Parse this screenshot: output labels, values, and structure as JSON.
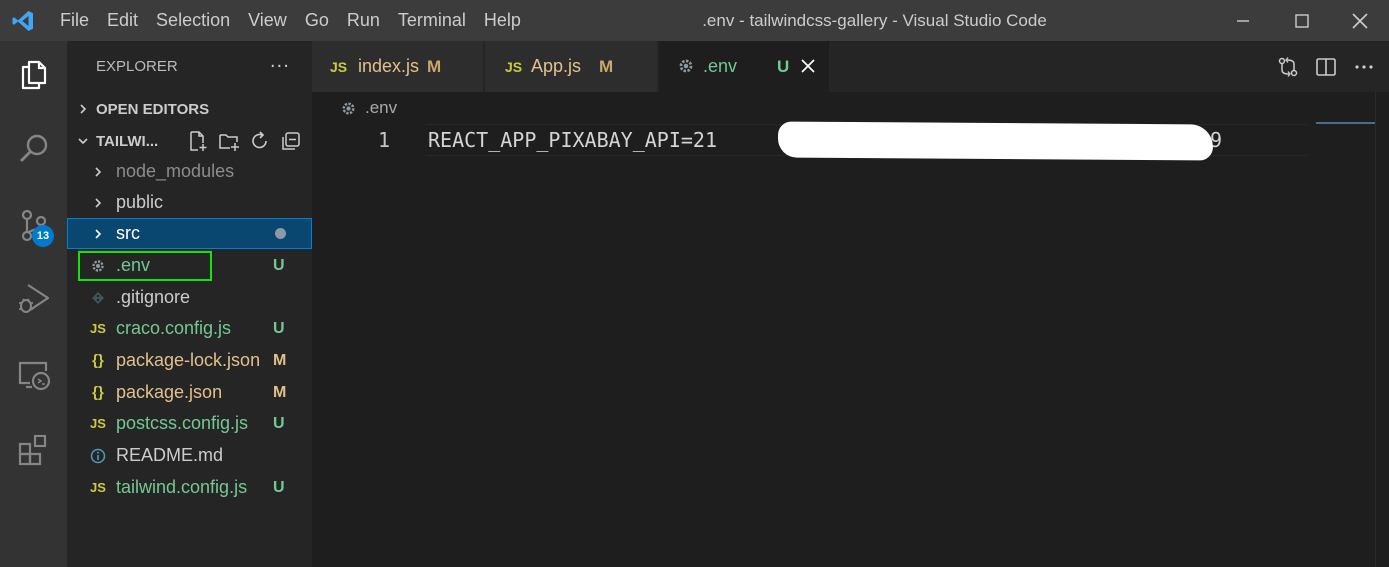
{
  "window": {
    "title": ".env - tailwindcss-gallery - Visual Studio Code",
    "menu": [
      "File",
      "Edit",
      "Selection",
      "View",
      "Go",
      "Run",
      "Terminal",
      "Help"
    ]
  },
  "activity_bar": {
    "items": [
      "files-icon",
      "search-icon",
      "source-control-icon",
      "run-debug-icon",
      "remote-explorer-icon",
      "extensions-icon"
    ],
    "source_control_badge": "13"
  },
  "sidebar": {
    "title": "EXPLORER",
    "more": "···",
    "open_editors_label": "OPEN EDITORS",
    "project_label": "TAILWI...",
    "files": [
      {
        "name": "node_modules",
        "icon": ">",
        "status": ""
      },
      {
        "name": "public",
        "icon": ">",
        "status": ""
      },
      {
        "name": "src",
        "icon": ">",
        "status": ""
      },
      {
        "name": ".env",
        "icon": "gear",
        "status": "U"
      },
      {
        "name": ".gitignore",
        "icon": "git",
        "status": ""
      },
      {
        "name": "craco.config.js",
        "icon": "JS",
        "status": "U"
      },
      {
        "name": "package-lock.json",
        "icon": "{}",
        "status": "M"
      },
      {
        "name": "package.json",
        "icon": "{}",
        "status": "M"
      },
      {
        "name": "postcss.config.js",
        "icon": "JS",
        "status": "U"
      },
      {
        "name": "README.md",
        "icon": "info",
        "status": ""
      },
      {
        "name": "tailwind.config.js",
        "icon": "JS",
        "status": "U"
      }
    ],
    "js_glyph": "JS",
    "json_glyph": "{}"
  },
  "tabs": [
    {
      "label": "index.js",
      "status": "M",
      "icon": "JS"
    },
    {
      "label": "App.js",
      "status": "M",
      "icon": "JS"
    },
    {
      "label": ".env",
      "status": "U",
      "icon": "gear"
    }
  ],
  "editor": {
    "breadcrumb": ".env",
    "line_number": "1",
    "code_visible_start": "REACT_APP_PIXABAY_API=21",
    "code_visible_end": "9"
  },
  "colors": {
    "accent": "#007acc",
    "untracked": "#73c991",
    "modified": "#e2c08d",
    "highlight_box": "#12e40c",
    "js_icon": "#cbcb41",
    "json_icon": "#cbcb41"
  }
}
